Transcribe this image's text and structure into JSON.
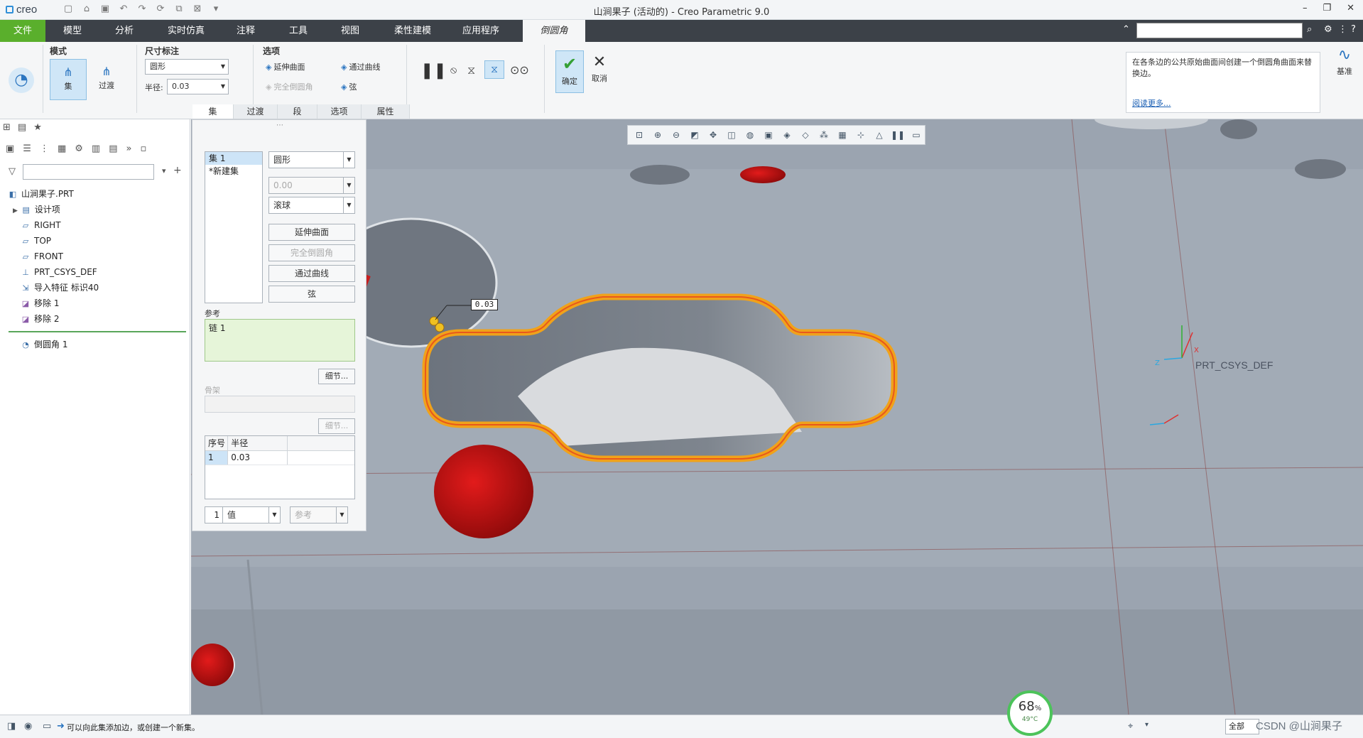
{
  "title_bar": {
    "logo": "creo",
    "title": "山涧果子 (活动的) - Creo Parametric 9.0",
    "minimize": "–",
    "restore": "❐",
    "close": "✕"
  },
  "menu": {
    "tabs": [
      "文件",
      "模型",
      "分析",
      "实时仿真",
      "注释",
      "工具",
      "视图",
      "柔性建模",
      "应用程序",
      "倒圆角"
    ],
    "active": "倒圆角",
    "accent": "#5aaf2c"
  },
  "ribbon": {
    "mode_title": "模式",
    "mode_set": "集",
    "mode_transition": "过渡",
    "dim_title": "尺寸标注",
    "shape_value": "圆形",
    "radius_label": "半径:",
    "radius_value": "0.03",
    "options_title": "选项",
    "extend_surfaces": "延伸曲面",
    "full_round": "完全倒圆角",
    "through_curve": "通过曲线",
    "chord": "弦",
    "ok": "确定",
    "cancel": "取消",
    "datum": "基准",
    "help_text": "在各条边的公共原始曲面间创建一个倒圆角曲面来替换边。",
    "help_link": "阅读更多...",
    "subtabs": [
      "集",
      "过渡",
      "段",
      "选项",
      "属性"
    ]
  },
  "model_tree": {
    "nodes": [
      "山涧果子.PRT",
      "设计项",
      "RIGHT",
      "TOP",
      "FRONT",
      "PRT_CSYS_DEF",
      "导入特征 标识40",
      "移除 1",
      "移除 2"
    ],
    "active_node": "倒圆角 1"
  },
  "sets_panel": {
    "sets": [
      "集 1",
      "*新建集"
    ],
    "shape": "圆形",
    "value_disabled": "0.00",
    "method": "滚球",
    "extend_surfaces": "延伸曲面",
    "full_round": "完全倒圆角",
    "through_curve": "通过曲线",
    "chord": "弦",
    "ref_label": "参考",
    "ref_value": "链 1",
    "details": "细节...",
    "skeleton_label": "骨架",
    "table_headers": [
      "序号",
      "半径"
    ],
    "table_rows": [
      [
        "1",
        "0.03"
      ]
    ],
    "count": "1",
    "value_mode": "值",
    "ref_mode": "参考"
  },
  "viewport": {
    "dimension_label": "0.03",
    "csys_label": "PRT_CSYS_DEF",
    "axis_x": "X",
    "axis_z": "Z"
  },
  "status_bar": {
    "message": "可以向此集添加边，或创建一个新集。",
    "filter": "全部",
    "watermark": "CSDN @山涧果子",
    "gauge_percent": "68",
    "gauge_temp": "49°C"
  }
}
